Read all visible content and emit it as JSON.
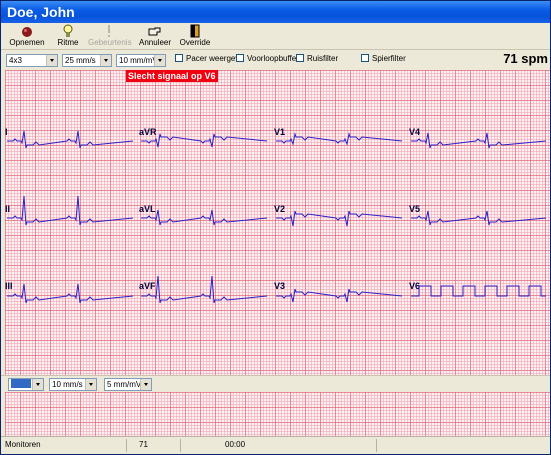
{
  "window": {
    "title": "Doe, John"
  },
  "toolbar": {
    "record_label": "Opnemen",
    "rhythm_label": "Ritme",
    "events_label": "Gebeurtenis",
    "cancel_label": "Annuleer",
    "override_label": "Override"
  },
  "options": {
    "layout_value": "4x3",
    "speed_value": "25 mm/s",
    "gain_value": "10 mm/mV",
    "pacer_label": "Pacer weergeve",
    "preview_label": "Voorloopbuffer",
    "noise_label": "Ruisfilter",
    "spike_label": "Spierfilter",
    "heart_rate": "71 spm"
  },
  "warning": {
    "text": "Slecht signaal op V6"
  },
  "leads": [
    "I",
    "aVR",
    "V1",
    "V4",
    "II",
    "aVL",
    "V2",
    "V5",
    "III",
    "aVF",
    "V3",
    "V6"
  ],
  "rhythm": {
    "lead_value": "",
    "speed_value": "10 mm/s",
    "gain_value": "5 mm/mV"
  },
  "status": {
    "mode": "Monitoren",
    "rate": "71",
    "time": "00:00"
  },
  "colors": {
    "trace": "#2a20c8",
    "warning_bg": "#f00010",
    "title_bar": "#0553dc"
  },
  "icons": {
    "record": "record-dot-icon",
    "rhythm": "lightbulb-icon",
    "events": "exclamation-icon",
    "cancel": "pointing-hand-icon",
    "override": "door-exit-icon"
  }
}
